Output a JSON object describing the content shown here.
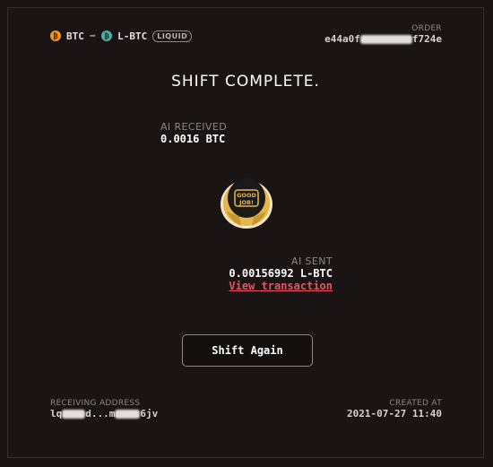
{
  "pair": {
    "from_symbol": "BTC",
    "from_coin_glyph": "₿",
    "arrow": "➡",
    "to_symbol": "L-BTC",
    "to_coin_glyph": "₿",
    "network_badge": "LIQUID",
    "from_icon": "bitcoin-icon",
    "to_icon": "liquid-bitcoin-icon"
  },
  "order": {
    "label": "ORDER",
    "id_start": "e44a0f",
    "id_end": "f724e"
  },
  "status": {
    "title": "SHIFT COMPLETE."
  },
  "received": {
    "label": "AI RECEIVED",
    "amount": "0.0016 BTC"
  },
  "mascot": {
    "icon": "fox-helmet-icon",
    "text_line1": "GOOD",
    "text_line2": "JOB!"
  },
  "sent": {
    "label": "AI SENT",
    "amount": "0.00156992 L-BTC",
    "link_text": "View transaction"
  },
  "actions": {
    "shift_again": "Shift Again"
  },
  "receiving_address": {
    "label": "RECEIVING ADDRESS",
    "start": "lq",
    "middle": "d...m",
    "end": "6jv"
  },
  "created_at": {
    "label": "CREATED AT",
    "value": "2021-07-27 11:40"
  },
  "colors": {
    "background": "#1b1414",
    "link": "#e9535f",
    "btc": "#f7931a",
    "liquid": "#46b5a5",
    "helmet_gold": "#e6b64a"
  }
}
